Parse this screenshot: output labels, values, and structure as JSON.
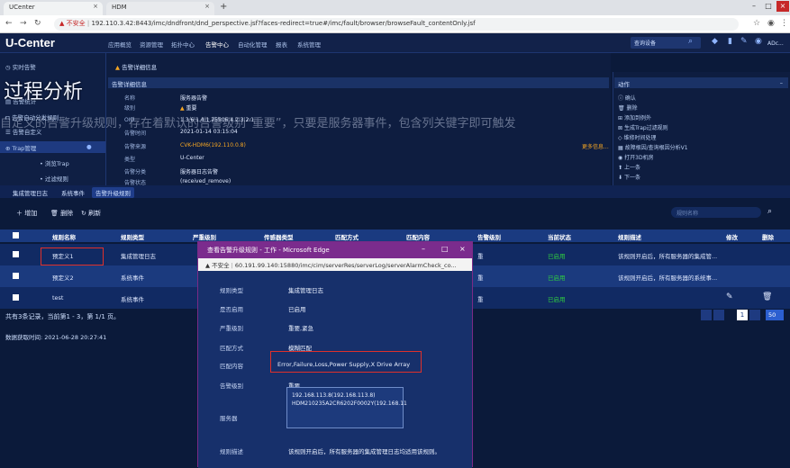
{
  "browser": {
    "tabs": [
      {
        "label": "UCenter"
      },
      {
        "label": "HDM"
      }
    ],
    "new_tab": "+",
    "security_warning": "不安全",
    "url": "192.110.3.42:8443/imc/dndfront/dnd_perspective.jsf?faces-redirect=true#/imc/fault/browser/browseFault_contentOnly.jsf"
  },
  "app": {
    "logo": "U-Center",
    "nav": [
      "应用概览",
      "资源管理",
      "拓扑中心",
      "告警中心",
      "自动化管理",
      "报表",
      "系统管理"
    ],
    "active_nav": "告警中心",
    "query_label": "查询设备",
    "user_label": "ADc..."
  },
  "sidebar": {
    "items": [
      {
        "label": "实时告警"
      },
      {
        "label": "告警统计"
      },
      {
        "label": "告警自动分发规则"
      },
      {
        "label": "告警自定义"
      },
      {
        "label": "Trap管理"
      },
      {
        "label": "浏览Trap"
      },
      {
        "label": "过滤规则"
      }
    ]
  },
  "detail": {
    "title": "告警详细信息",
    "section": "告警详细信息",
    "rows": [
      {
        "label": "名称",
        "value": "服务器告警"
      },
      {
        "label": "级别",
        "value": "重要"
      },
      {
        "label": "OID",
        "value": "1.3.6.1.4.1.25506.4.2.3.2.1"
      },
      {
        "label": "告警时间",
        "value": "2021-01-14 03:15:04"
      },
      {
        "label": "告警来源",
        "value": "CVK-HDM6(192.110.0.8)"
      },
      {
        "label": "类型",
        "value": "U-Center"
      },
      {
        "label": "告警分类",
        "value": "服务器日志告警"
      },
      {
        "label": "告警状态",
        "value": "(received_remove)"
      }
    ],
    "more_info": "更多信息..."
  },
  "actions": {
    "title": "动作",
    "items": [
      "确认",
      "删除",
      "添加到例外",
      "生成Trap过滤规则",
      "维修时间处理",
      "故障根因/查询根因分析V1",
      "打开3D机房",
      "上一条",
      "下一条"
    ]
  },
  "overlay": {
    "title": "过程分析",
    "body": "自定义的告警升级规则，存在着默认的告警级别“重要”，只要是服务器事件，包含列关键字即可触发"
  },
  "subtabs": [
    "集成管理日志",
    "系统事件",
    "告警升级规则"
  ],
  "toolbar": {
    "add": "增加",
    "delete": "删除",
    "refresh": "刷新",
    "search_placeholder": "规则名称"
  },
  "table": {
    "headers": [
      "规则名称",
      "规则类型",
      "严重级别",
      "传感器类型",
      "匹配方式",
      "匹配内容",
      "告警级别",
      "当前状态",
      "规则描述",
      "修改",
      "删除"
    ],
    "rows": [
      {
        "name": "预定义1",
        "type": "集成管理日志",
        "status": "已启用",
        "desc": "该规则开启后，所有服务器的集成管..."
      },
      {
        "name": "预定义2",
        "type": "系统事件",
        "status": "已启用",
        "desc": "该规则开启后，所有服务器的系统事..."
      },
      {
        "name": "test",
        "type": "系统事件",
        "status": "已启用",
        "desc": ""
      }
    ],
    "summary": "共有3条记录，当前第1 - 3，第 1/1 页。",
    "page": "1",
    "page_size": "50"
  },
  "fetch_time": "数据获取时间: 2021-06-28 20:27:41",
  "edge": {
    "title": "查看告警升级规则 - 工作 - Microsoft Edge",
    "security": "不安全",
    "url": "60.191.99.140:15880/imc/cim/serverRes/serverLog/serverAlarmCheck_co...",
    "fields": [
      {
        "label": "规则类型",
        "value": "集成管理日志"
      },
      {
        "label": "是否启用",
        "value": "已启用"
      },
      {
        "label": "严重级别",
        "value": "重要,紧急"
      },
      {
        "label": "匹配方式",
        "value": "模糊匹配"
      },
      {
        "label": "匹配内容",
        "value": "Error,Failure,Loss,Power Supply,X Drive Array"
      },
      {
        "label": "告警级别",
        "value": "重要"
      },
      {
        "label": "服务器",
        "value": ""
      },
      {
        "label": "规则描述",
        "value": "该规则开启后，所有服务器的集成管理日志均适用该规则。"
      }
    ],
    "servers": [
      "192.168.113.8(192.168.113.8)",
      "HDM210235A2CR6202F0002Y(192.168.11"
    ]
  },
  "colors": {
    "accent": "#1f3d8a",
    "warning": "#e0302a",
    "enabled": "#2ecc40",
    "edge_title": "#7b2c8d"
  }
}
